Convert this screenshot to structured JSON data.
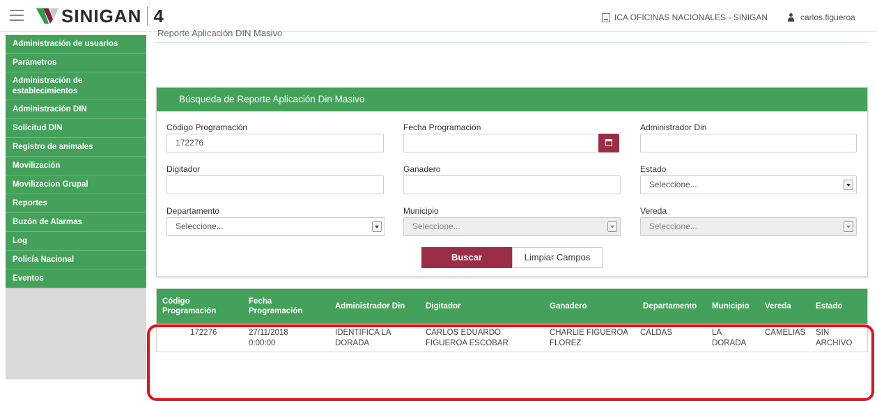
{
  "header": {
    "brand": "SINIGAN",
    "version": "4",
    "office": "ICA OFICINAS NACIONALES - SINIGAN",
    "user": "carlos.figueroa"
  },
  "sidebar": {
    "items": [
      {
        "label": "Administración de usuarios"
      },
      {
        "label": "Parámetros"
      },
      {
        "label": "Administración de establecimientos"
      },
      {
        "label": "Administración DIN"
      },
      {
        "label": "Solicitud DIN"
      },
      {
        "label": "Registro de animales"
      },
      {
        "label": "Movilización"
      },
      {
        "label": "Movilizacion Grupal"
      },
      {
        "label": "Reportes"
      },
      {
        "label": "Buzón de Alarmas"
      },
      {
        "label": "Log"
      },
      {
        "label": "Policía Nacional"
      },
      {
        "label": "Eventos"
      }
    ]
  },
  "page": {
    "title": "Reporte Aplicación DIN Masivo"
  },
  "search": {
    "title": "Búsqueda de Reporte Aplicación Din Masivo",
    "codigo_label": "Código Programación",
    "codigo_value": "172276",
    "fecha_label": "Fecha Programación",
    "fecha_value": "",
    "admin_label": "Administrador Din",
    "admin_value": "",
    "digitador_label": "Digitador",
    "digitador_value": "",
    "ganadero_label": "Ganadero",
    "ganadero_value": "",
    "estado_label": "Estado",
    "estado_value": "Seleccione...",
    "departamento_label": "Departamento",
    "departamento_value": "Seleccione...",
    "municipio_label": "Municipio",
    "municipio_value": "Seleccione...",
    "vereda_label": "Vereda",
    "vereda_value": "Seleccione...",
    "buscar_label": "Buscar",
    "limpiar_label": "Limpiar Campos"
  },
  "table": {
    "headers": [
      "Código Programación",
      "Fecha Programación",
      "Administrador Din",
      "Digitador",
      "Ganadero",
      "Departamento",
      "Municipio",
      "Vereda",
      "Estado"
    ],
    "rows": [
      {
        "codigo": "172276",
        "fecha": "27/11/2018 0:00:00",
        "administrador": "IDENTIFICA LA DORADA",
        "digitador": "CARLOS EDUARDO FIGUEROA ESCOBAR",
        "ganadero": "CHARLIE FIGUEROA FLOREZ",
        "departamento": "CALDAS",
        "municipio": "LA DORADA",
        "vereda": "CAMELIAS",
        "estado": "SIN ARCHIVO"
      }
    ]
  },
  "colors": {
    "primary_green": "#43a15a",
    "accent_maroon": "#9b2d47",
    "highlight_red": "#e8111b"
  }
}
